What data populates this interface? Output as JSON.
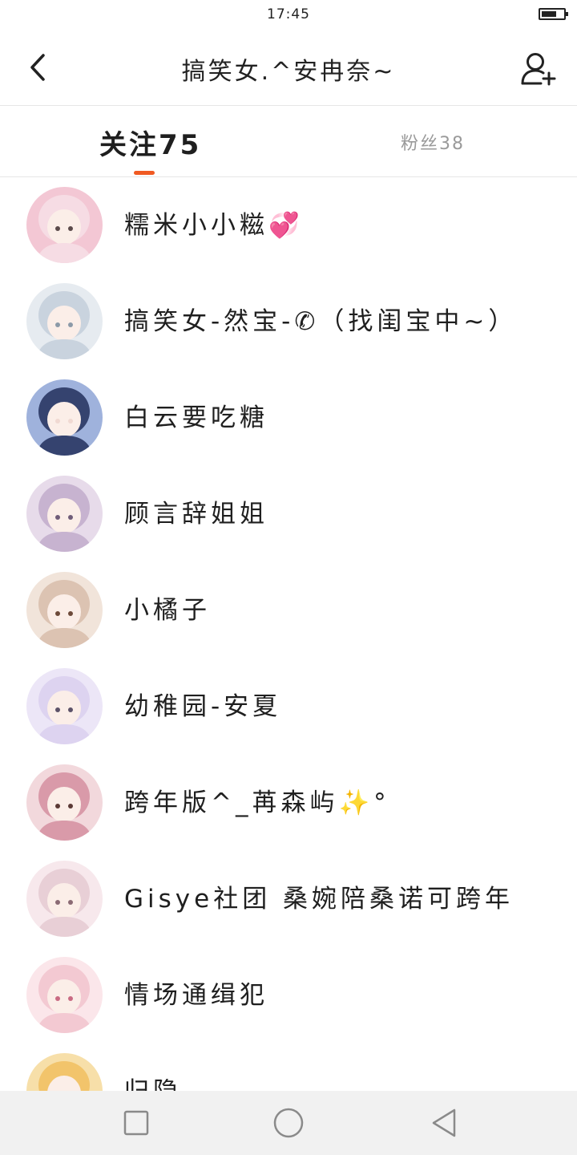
{
  "status_bar": {
    "time": "17:45",
    "battery_level": 0.7
  },
  "header": {
    "title": "搞笑女.^安冉奈~",
    "back_icon": "chevron-left-icon",
    "add_user_icon": "add-user-icon"
  },
  "tabs": {
    "following_label": "关注75",
    "followers_label": "粉丝38",
    "active": "following",
    "accent_color": "#f05a22"
  },
  "users": [
    {
      "name": "糯米小小糍💞",
      "avatar_colors": [
        "#f6dce4",
        "#f3c7d4",
        "#5a4a4a"
      ]
    },
    {
      "name": "搞笑女-然宝-✆（找闺宝中~）",
      "avatar_colors": [
        "#c9d3de",
        "#e6ebf0",
        "#8c9aa8"
      ]
    },
    {
      "name": "白云要吃糖",
      "avatar_colors": [
        "#35436f",
        "#9fb2dc",
        "#f0d9d2"
      ]
    },
    {
      "name": "顾言辞姐姐",
      "avatar_colors": [
        "#c7b3d0",
        "#e7dbea",
        "#6f5c78"
      ]
    },
    {
      "name": "小橘子",
      "avatar_colors": [
        "#dcc3b2",
        "#f1e4da",
        "#6d4a3a"
      ]
    },
    {
      "name": "幼稚园-安夏",
      "avatar_colors": [
        "#ddd3f0",
        "#ece6f7",
        "#5c5268"
      ]
    },
    {
      "name": "跨年版^_苒森屿✨°",
      "avatar_colors": [
        "#d99aa9",
        "#f2d8dc",
        "#5b3a36"
      ]
    },
    {
      "name": "Gisye社团 桑婉陪桑诺可跨年",
      "avatar_colors": [
        "#e8cfd6",
        "#f7e8ec",
        "#8a6a74"
      ]
    },
    {
      "name": "情场通缉犯",
      "avatar_colors": [
        "#f3c9d2",
        "#fbe6ea",
        "#c96b83"
      ]
    },
    {
      "name": "归隐",
      "avatar_colors": [
        "#f2c46b",
        "#f7dfa9",
        "#b97a32"
      ]
    }
  ],
  "nav_bar": {
    "recent_icon": "square-icon",
    "home_icon": "circle-icon",
    "back_icon": "triangle-back-icon"
  }
}
